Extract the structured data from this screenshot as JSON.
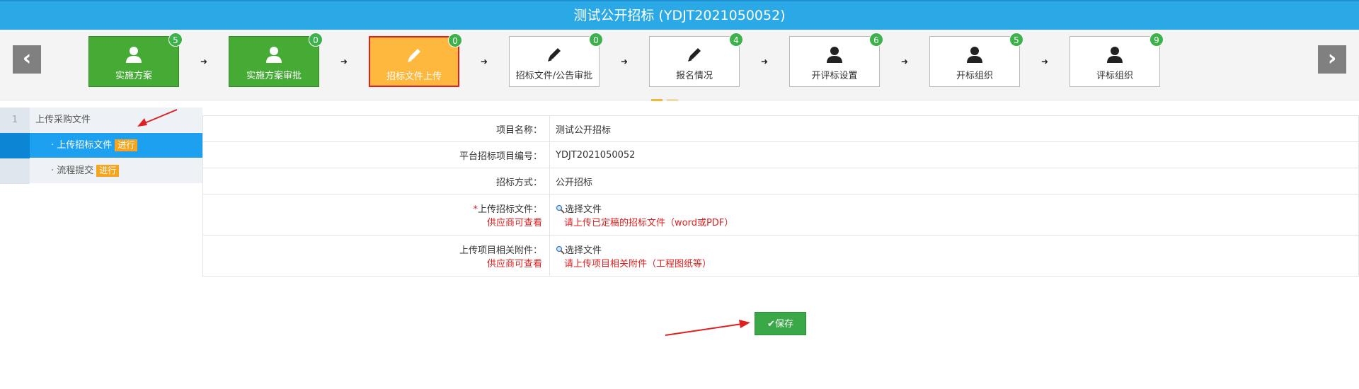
{
  "header": {
    "title": "测试公开招标 (YDJT2021050052)"
  },
  "steps": [
    {
      "label": "实施方案",
      "count": "5",
      "icon": "user-icon",
      "state": "done"
    },
    {
      "label": "实施方案审批",
      "count": "0",
      "icon": "user-icon",
      "state": "done"
    },
    {
      "label": "招标文件上传",
      "count": "0",
      "icon": "pencil-icon",
      "state": "active"
    },
    {
      "label": "招标文件/公告审批",
      "count": "0",
      "icon": "pencil-icon",
      "state": "todo"
    },
    {
      "label": "报名情况",
      "count": "4",
      "icon": "pencil-icon",
      "state": "todo"
    },
    {
      "label": "开评标设置",
      "count": "6",
      "icon": "user-icon",
      "state": "todo"
    },
    {
      "label": "开标组织",
      "count": "5",
      "icon": "user-icon",
      "state": "todo"
    },
    {
      "label": "评标组织",
      "count": "9",
      "icon": "user-icon",
      "state": "todo"
    }
  ],
  "nav": {
    "prev": "‹",
    "next": "›"
  },
  "leftnav": {
    "section_num": "1",
    "section_label": "上传采购文件",
    "items": [
      {
        "label": "· 上传招标文件",
        "tag": "进行"
      },
      {
        "label": "· 流程提交",
        "tag": "进行"
      }
    ]
  },
  "form": {
    "project_name_label": "项目名称：",
    "project_name_value": "测试公开招标",
    "project_code_label": "平台招标项目编号：",
    "project_code_value": "YDJT2021050052",
    "method_label": "招标方式：",
    "method_value": "公开招标",
    "upload_doc_required": "*",
    "upload_doc_label": "上传招标文件：",
    "upload_doc_note": "供应商可查看",
    "upload_doc_picker": "选择文件",
    "upload_doc_hint": "请上传已定稿的招标文件（word或PDF）",
    "upload_att_label": "上传项目相关附件：",
    "upload_att_note": "供应商可查看",
    "upload_att_picker": "选择文件",
    "upload_att_hint": "请上传项目相关附件（工程图纸等）"
  },
  "actions": {
    "save": "保存"
  },
  "colors": {
    "header": "#2aa9e6",
    "done": "#46ab34",
    "active": "#ffb83e",
    "badge": "#3bb34a",
    "accent_red": "#e02020"
  }
}
